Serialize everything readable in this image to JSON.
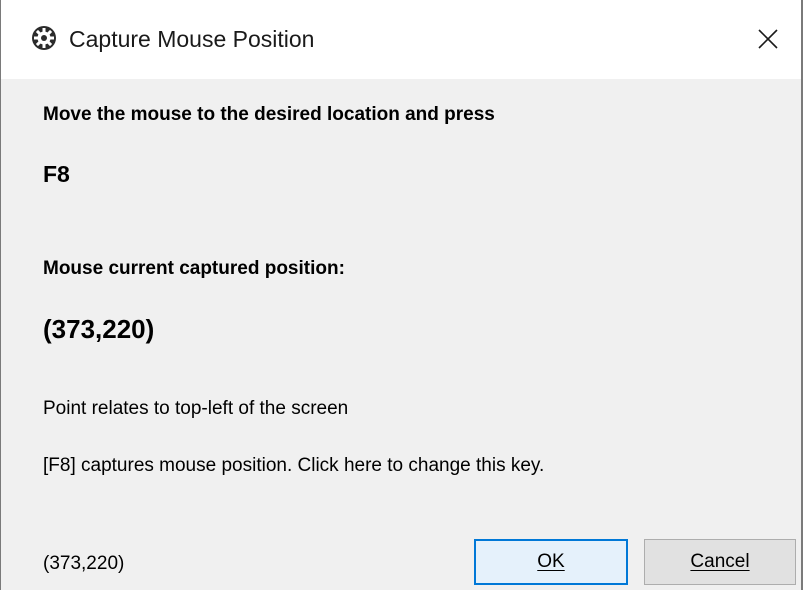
{
  "window": {
    "title": "Capture Mouse Position",
    "icon": "gear-icon",
    "close_glyph": "✕"
  },
  "content": {
    "instruction": "Move the mouse to the desired location and press",
    "hotkey": "F8",
    "position_label": "Mouse current captured position:",
    "position_value": "(373,220)",
    "note": "Point relates to top-left of the screen",
    "change_key_text": "[F8] captures mouse position.  Click here to change this key."
  },
  "footer": {
    "live_position": "(373,220)",
    "ok_label": "OK",
    "cancel_label": "Cancel"
  },
  "colors": {
    "content_bg": "#f0f0f0",
    "button_bg": "#e1e1e1",
    "default_button_border": "#0078d7"
  }
}
